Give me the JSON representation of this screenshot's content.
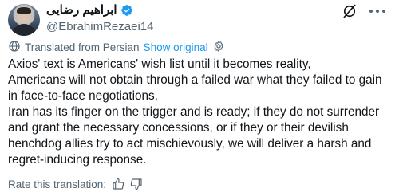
{
  "author": {
    "display_name": "ابراهیم رضایی",
    "handle": "@EbrahimRezaei14",
    "verified_color": "#1d9bf0"
  },
  "header_icons": {
    "grok": "grok-icon",
    "more": "more-dots-icon"
  },
  "translation": {
    "label": "Translated from Persian",
    "show_original": "Show original",
    "icon": "translate-icon",
    "settings_icon": "gear-icon"
  },
  "tweet": {
    "lines": [
      "Axios' text is Americans' wish list until it becomes reality,",
      "Americans will not obtain through a failed war what they failed to gain in face-to-face negotiations,",
      "Iran has its finger on the trigger and is ready; if they do not surrender and grant the necessary concessions, or if they or their devilish henchdog allies try to act mischievously, we will deliver a harsh and regret-inducing response."
    ]
  },
  "rating": {
    "label": "Rate this translation:",
    "up_icon": "thumbs-up-icon",
    "down_icon": "thumbs-down-icon"
  }
}
